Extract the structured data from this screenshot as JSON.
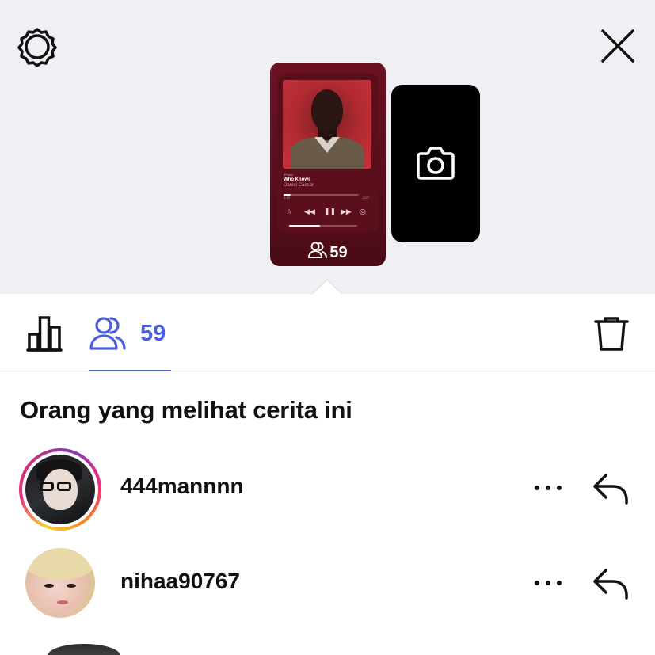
{
  "header": {
    "settings_icon": "gear-icon",
    "close_icon": "close-icon"
  },
  "story_preview": {
    "now_playing": {
      "source": "iPhone",
      "song": "Who Knows",
      "artist": "Daniel Caesar",
      "elapsed": "0:19",
      "remaining": "-3:27",
      "progress": 0.09,
      "volume": 0.45
    },
    "viewer_count": "59",
    "accent": "#5e0f1d"
  },
  "tabs": {
    "stats_icon": "bar-chart-icon",
    "viewers_icon": "viewers-icon",
    "viewers_count": "59",
    "active": "viewers",
    "accent": "#4a5ee0",
    "delete_icon": "trash-icon"
  },
  "viewers_section": {
    "title": "Orang yang melihat cerita ini",
    "items": [
      {
        "username": "444mannnn",
        "has_story_ring": true
      },
      {
        "username": "nihaa90767",
        "has_story_ring": false
      }
    ]
  }
}
